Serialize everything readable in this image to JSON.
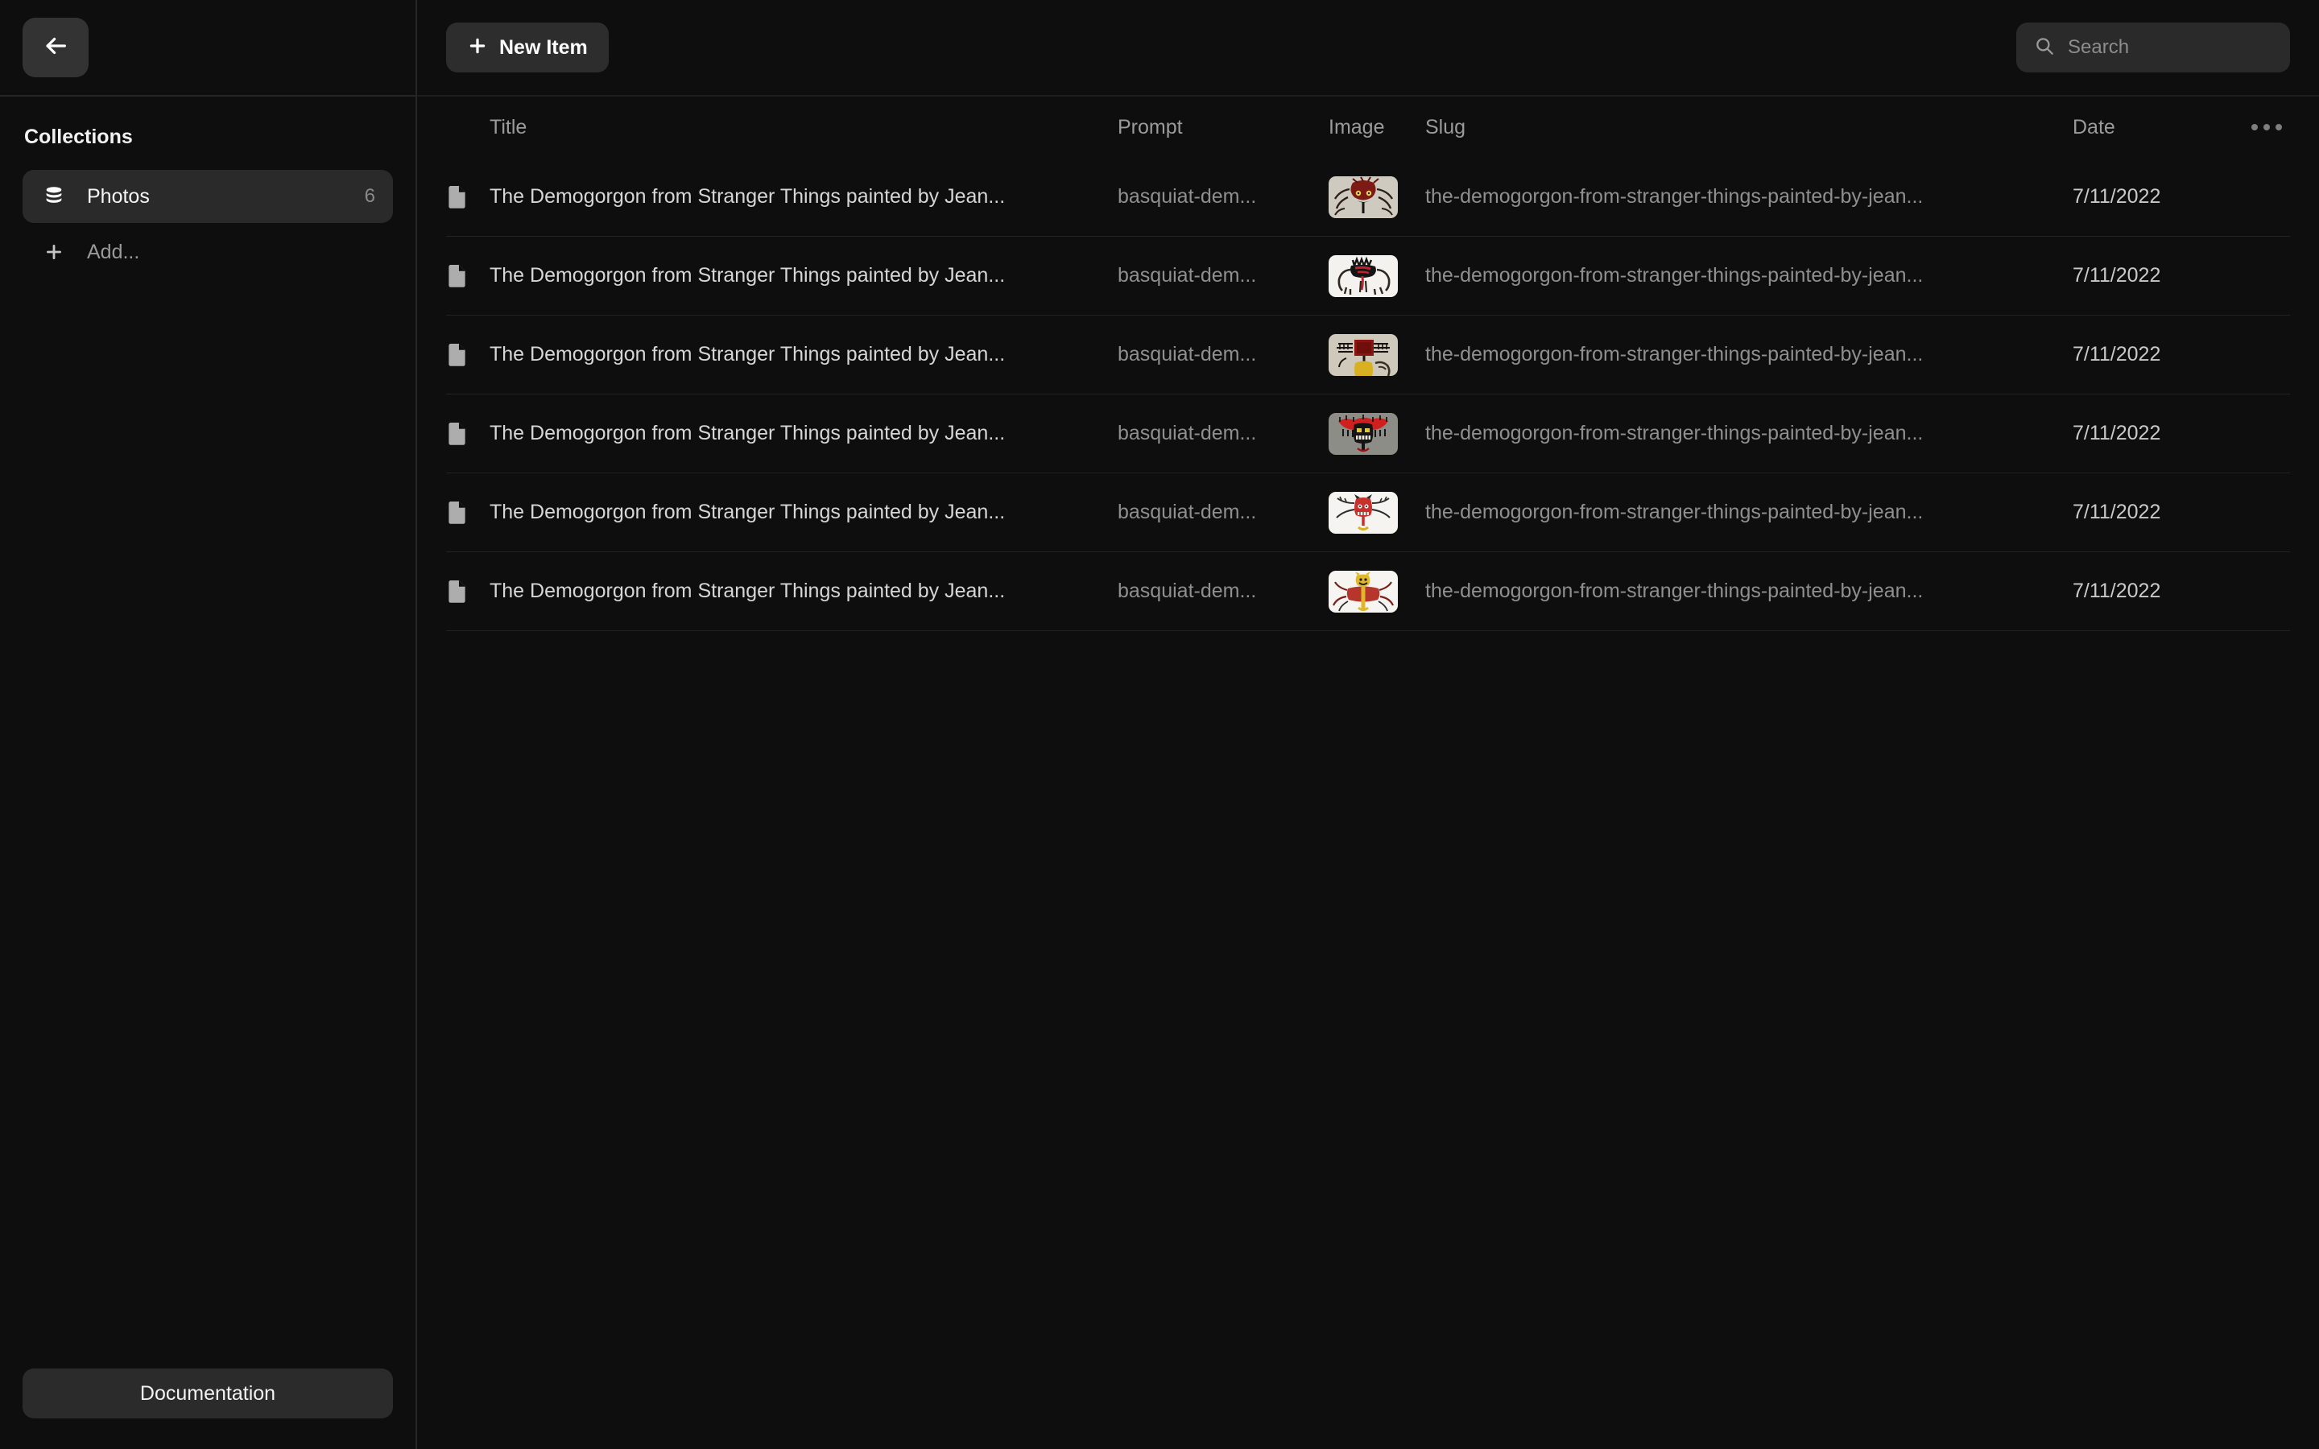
{
  "sidebar": {
    "back_icon": "arrow-left-icon",
    "collections_heading": "Collections",
    "items": [
      {
        "icon": "database-stack-icon",
        "label": "Photos",
        "count": "6",
        "active": true
      }
    ],
    "add_label": "Add...",
    "add_icon": "plus-icon",
    "documentation_label": "Documentation"
  },
  "toolbar": {
    "new_item_label": "New Item",
    "new_item_icon": "plus-icon",
    "search_icon": "search-icon",
    "search_placeholder": "Search",
    "search_value": ""
  },
  "table": {
    "columns": {
      "title": "Title",
      "prompt": "Prompt",
      "image": "Image",
      "slug": "Slug",
      "date": "Date"
    },
    "overflow_icon": "ellipsis-icon",
    "row_icon": "file-document-icon",
    "rows": [
      {
        "title": "The Demogorgon from Stranger Things painted by Jean...",
        "prompt": "basquiat-dem...",
        "image_alt": "demogorgon-red-head-yellow-eyes",
        "slug": "the-demogorgon-from-stranger-things-painted-by-jean...",
        "date": "7/11/2022"
      },
      {
        "title": "The Demogorgon from Stranger Things painted by Jean...",
        "prompt": "basquiat-dem...",
        "image_alt": "demogorgon-black-red-scribble-white",
        "slug": "the-demogorgon-from-stranger-things-painted-by-jean...",
        "date": "7/11/2022"
      },
      {
        "title": "The Demogorgon from Stranger Things painted by Jean...",
        "prompt": "basquiat-dem...",
        "image_alt": "demogorgon-red-square-head-yellow-body",
        "slug": "the-demogorgon-from-stranger-things-painted-by-jean...",
        "date": "7/11/2022"
      },
      {
        "title": "The Demogorgon from Stranger Things painted by Jean...",
        "prompt": "basquiat-dem...",
        "image_alt": "demogorgon-red-crown-black-face",
        "slug": "the-demogorgon-from-stranger-things-painted-by-jean...",
        "date": "7/11/2022"
      },
      {
        "title": "The Demogorgon from Stranger Things painted by Jean...",
        "prompt": "basquiat-dem...",
        "image_alt": "demogorgon-red-face-white-background",
        "slug": "the-demogorgon-from-stranger-things-painted-by-jean...",
        "date": "7/11/2022"
      },
      {
        "title": "The Demogorgon from Stranger Things painted by Jean...",
        "prompt": "basquiat-dem...",
        "image_alt": "demogorgon-yellow-head-red-body",
        "slug": "the-demogorgon-from-stranger-things-painted-by-jean...",
        "date": "7/11/2022"
      }
    ]
  },
  "colors": {
    "background": "#0e0e0e",
    "panel": "#2a2a2a",
    "divider": "#262626",
    "text_primary": "#f2f2f2",
    "text_muted": "#8f8f8f"
  }
}
